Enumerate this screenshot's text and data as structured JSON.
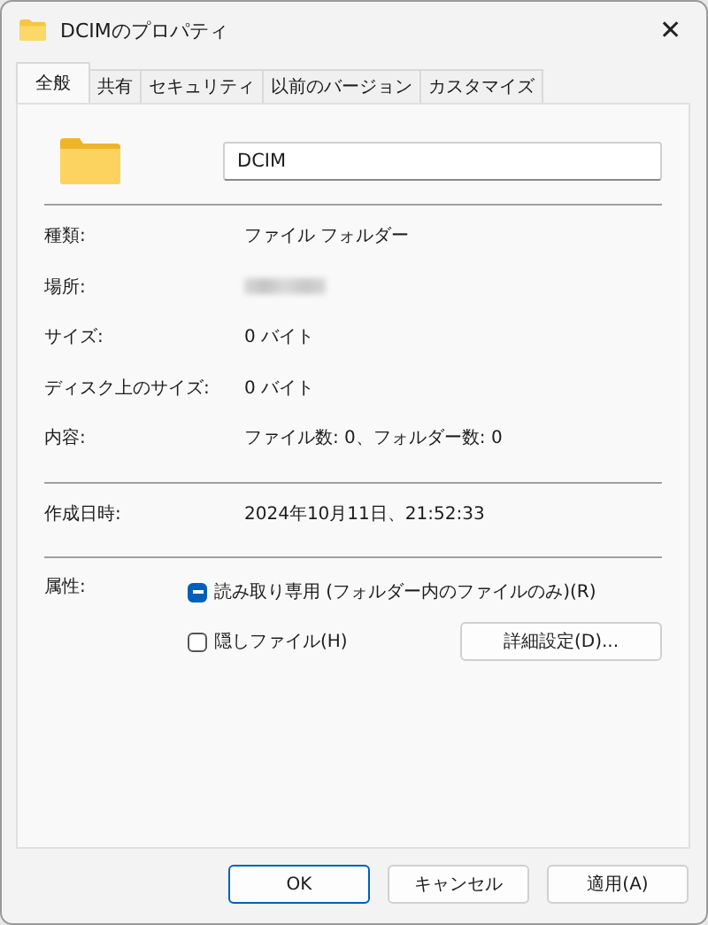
{
  "window": {
    "title": "DCIMのプロパティ",
    "close": "✕"
  },
  "tabs": [
    {
      "label": "全般",
      "selected": true
    },
    {
      "label": "共有",
      "selected": false
    },
    {
      "label": "セキュリティ",
      "selected": false
    },
    {
      "label": "以前のバージョン",
      "selected": false
    },
    {
      "label": "カスタマイズ",
      "selected": false
    }
  ],
  "name_field": {
    "value": "DCIM"
  },
  "properties": [
    {
      "label": "種類:",
      "value": "ファイル フォルダー",
      "kind": "text"
    },
    {
      "label": "場所:",
      "kind": "blurred"
    },
    {
      "label": "サイズ:",
      "value": "0 バイト",
      "kind": "text"
    },
    {
      "label": "ディスク上のサイズ:",
      "value": "0 バイト",
      "kind": "text"
    },
    {
      "label": "内容:",
      "value": "ファイル数: 0、フォルダー数: 0",
      "kind": "text"
    }
  ],
  "created": {
    "label": "作成日時:",
    "value": "2024年10月11日、21:52:33"
  },
  "attributes": {
    "label": "属性:",
    "options": [
      {
        "label": "読み取り専用 (フォルダー内のファイルのみ)(R)",
        "kind": "indeterminate"
      },
      {
        "label": "隠しファイル(H)",
        "kind": "unchecked"
      }
    ],
    "advanced_button": "詳細設定(D)..."
  },
  "buttons": [
    {
      "label": "OK",
      "default": true
    },
    {
      "label": "キャンセル",
      "default": false
    },
    {
      "label": "適用(A)",
      "default": false
    }
  ]
}
